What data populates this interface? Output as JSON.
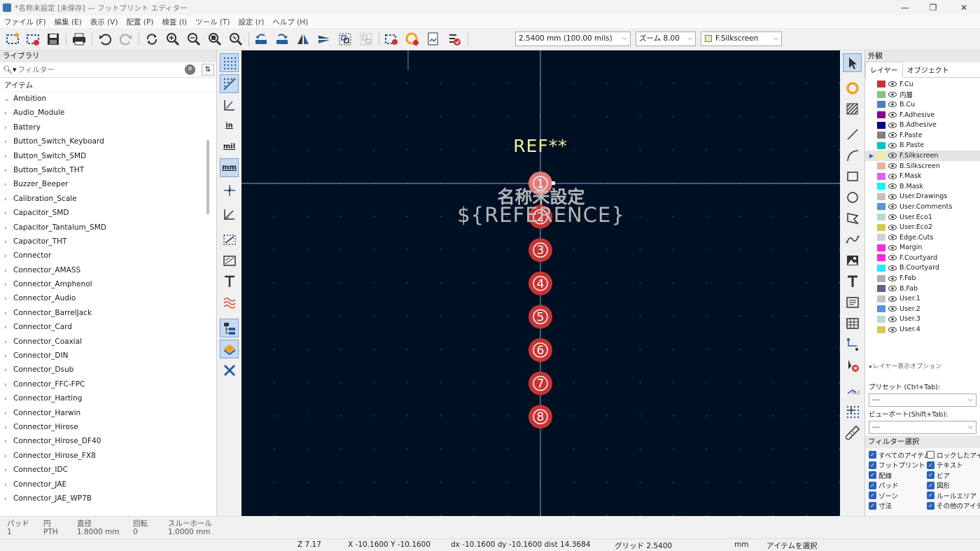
{
  "window": {
    "title": "*名称未設定 [未保存] — フットプリント エディター",
    "min": "—",
    "max": "❐",
    "close": "✕"
  },
  "menu": [
    "ファイル (F)",
    "編集 (E)",
    "表示 (V)",
    "配置 (P)",
    "検査 (I)",
    "ツール (T)",
    "設定 (r)",
    "ヘルプ (H)"
  ],
  "toolbar": {
    "grid": "2.5400 mm (100.00 mils)",
    "zoom": "ズーム 8.00",
    "layer": "F.Silkscreen",
    "layer_color": "#f2eda1"
  },
  "library": {
    "header": "ライブラリ",
    "filter_placeholder": "フィルター",
    "column": "アイテム",
    "items": [
      "Ambition",
      "Audio_Module",
      "Battery",
      "Button_Switch_Keyboard",
      "Button_Switch_SMD",
      "Button_Switch_THT",
      "Buzzer_Beeper",
      "Calibration_Scale",
      "Capacitor_SMD",
      "Capacitor_Tantalum_SMD",
      "Capacitor_THT",
      "Connector",
      "Connector_AMASS",
      "Connector_Amphenol",
      "Connector_Audio",
      "Connector_BarrelJack",
      "Connector_Card",
      "Connector_Coaxial",
      "Connector_DIN",
      "Connector_Dsub",
      "Connector_FFC-FPC",
      "Connector_Harting",
      "Connector_Harwin",
      "Connector_Hirose",
      "Connector_Hirose_DF40",
      "Connector_Hirose_FX8",
      "Connector_IDC",
      "Connector_JAE",
      "Connector_JAE_WP7B"
    ]
  },
  "canvas": {
    "ref": "REF**",
    "value": "名称未設定",
    "ref_field": "${REFERENCE}",
    "pads": [
      "1",
      "2",
      "3",
      "4",
      "5",
      "6",
      "7",
      "8"
    ]
  },
  "appearance": {
    "header": "外観",
    "tab_layers": "レイヤー",
    "tab_objects": "オブジェクト",
    "layers": [
      {
        "name": "F.Cu",
        "color": "#c83434"
      },
      {
        "name": "内層",
        "color": "#7fc87f"
      },
      {
        "name": "B.Cu",
        "color": "#4d7fc4"
      },
      {
        "name": "F.Adhesive",
        "color": "#84008f"
      },
      {
        "name": "B.Adhesive",
        "color": "#00008b"
      },
      {
        "name": "F.Paste",
        "color": "#808080"
      },
      {
        "name": "B.Paste",
        "color": "#00c2c2"
      },
      {
        "name": "F.Silkscreen",
        "color": "#f2eda1"
      },
      {
        "name": "B.Silkscreen",
        "color": "#e8b2a7"
      },
      {
        "name": "F.Mask",
        "color": "#d864ff"
      },
      {
        "name": "B.Mask",
        "color": "#02ffee"
      },
      {
        "name": "User.Drawings",
        "color": "#c2c2c2"
      },
      {
        "name": "User.Comments",
        "color": "#5994dc"
      },
      {
        "name": "User.Eco1",
        "color": "#b4dbd2"
      },
      {
        "name": "User.Eco2",
        "color": "#d8c852"
      },
      {
        "name": "Edge.Cuts",
        "color": "#d0d2cd"
      },
      {
        "name": "Margin",
        "color": "#ff26e2"
      },
      {
        "name": "F.Courtyard",
        "color": "#ff26e2"
      },
      {
        "name": "B.Courtyard",
        "color": "#26e9ff"
      },
      {
        "name": "F.Fab",
        "color": "#afafaf"
      },
      {
        "name": "B.Fab",
        "color": "#58658c"
      },
      {
        "name": "User.1",
        "color": "#c2c2c2"
      },
      {
        "name": "User.2",
        "color": "#5994dc"
      },
      {
        "name": "User.3",
        "color": "#b4dbd2"
      },
      {
        "name": "User.4",
        "color": "#d8c852"
      }
    ],
    "display_options": "レイヤー表示オプション",
    "preset_label": "プリセット (Ctrl+Tab):",
    "preset_value": "---",
    "viewport_label": "ビューポート(Shift+Tab):",
    "viewport_value": "---"
  },
  "filter": {
    "header": "フィルター選択",
    "items": [
      {
        "label": "すべてのアイテム",
        "on": true
      },
      {
        "label": "ロックしたアイテム",
        "on": false
      },
      {
        "label": "フットプリント",
        "on": true
      },
      {
        "label": "テキスト",
        "on": true
      },
      {
        "label": "配線",
        "on": true
      },
      {
        "label": "ビア",
        "on": true
      },
      {
        "label": "パッド",
        "on": true
      },
      {
        "label": "図形",
        "on": true
      },
      {
        "label": "ゾーン",
        "on": true
      },
      {
        "label": "ルールエリア",
        "on": true
      },
      {
        "label": "寸法",
        "on": true
      },
      {
        "label": "その他のアイテム",
        "on": true
      }
    ]
  },
  "messages": {
    "pad_h": "パッド",
    "pad_v": "1",
    "type_h": "円",
    "type_v": "PTH",
    "dia_h": "直径",
    "dia_v": "1.8000 mm",
    "rot_h": "回転",
    "rot_v": "0",
    "hole_h": "スルーホール",
    "hole_v": "1.0000 mm"
  },
  "status": {
    "z": "Z 7.17",
    "xy": "X -10.1600  Y -10.1600",
    "d": "dx -10.1600  dy -10.1600  dist 14.3684",
    "grid": "グリッド 2.5400",
    "units": "mm",
    "mode": "アイテムを選択"
  }
}
